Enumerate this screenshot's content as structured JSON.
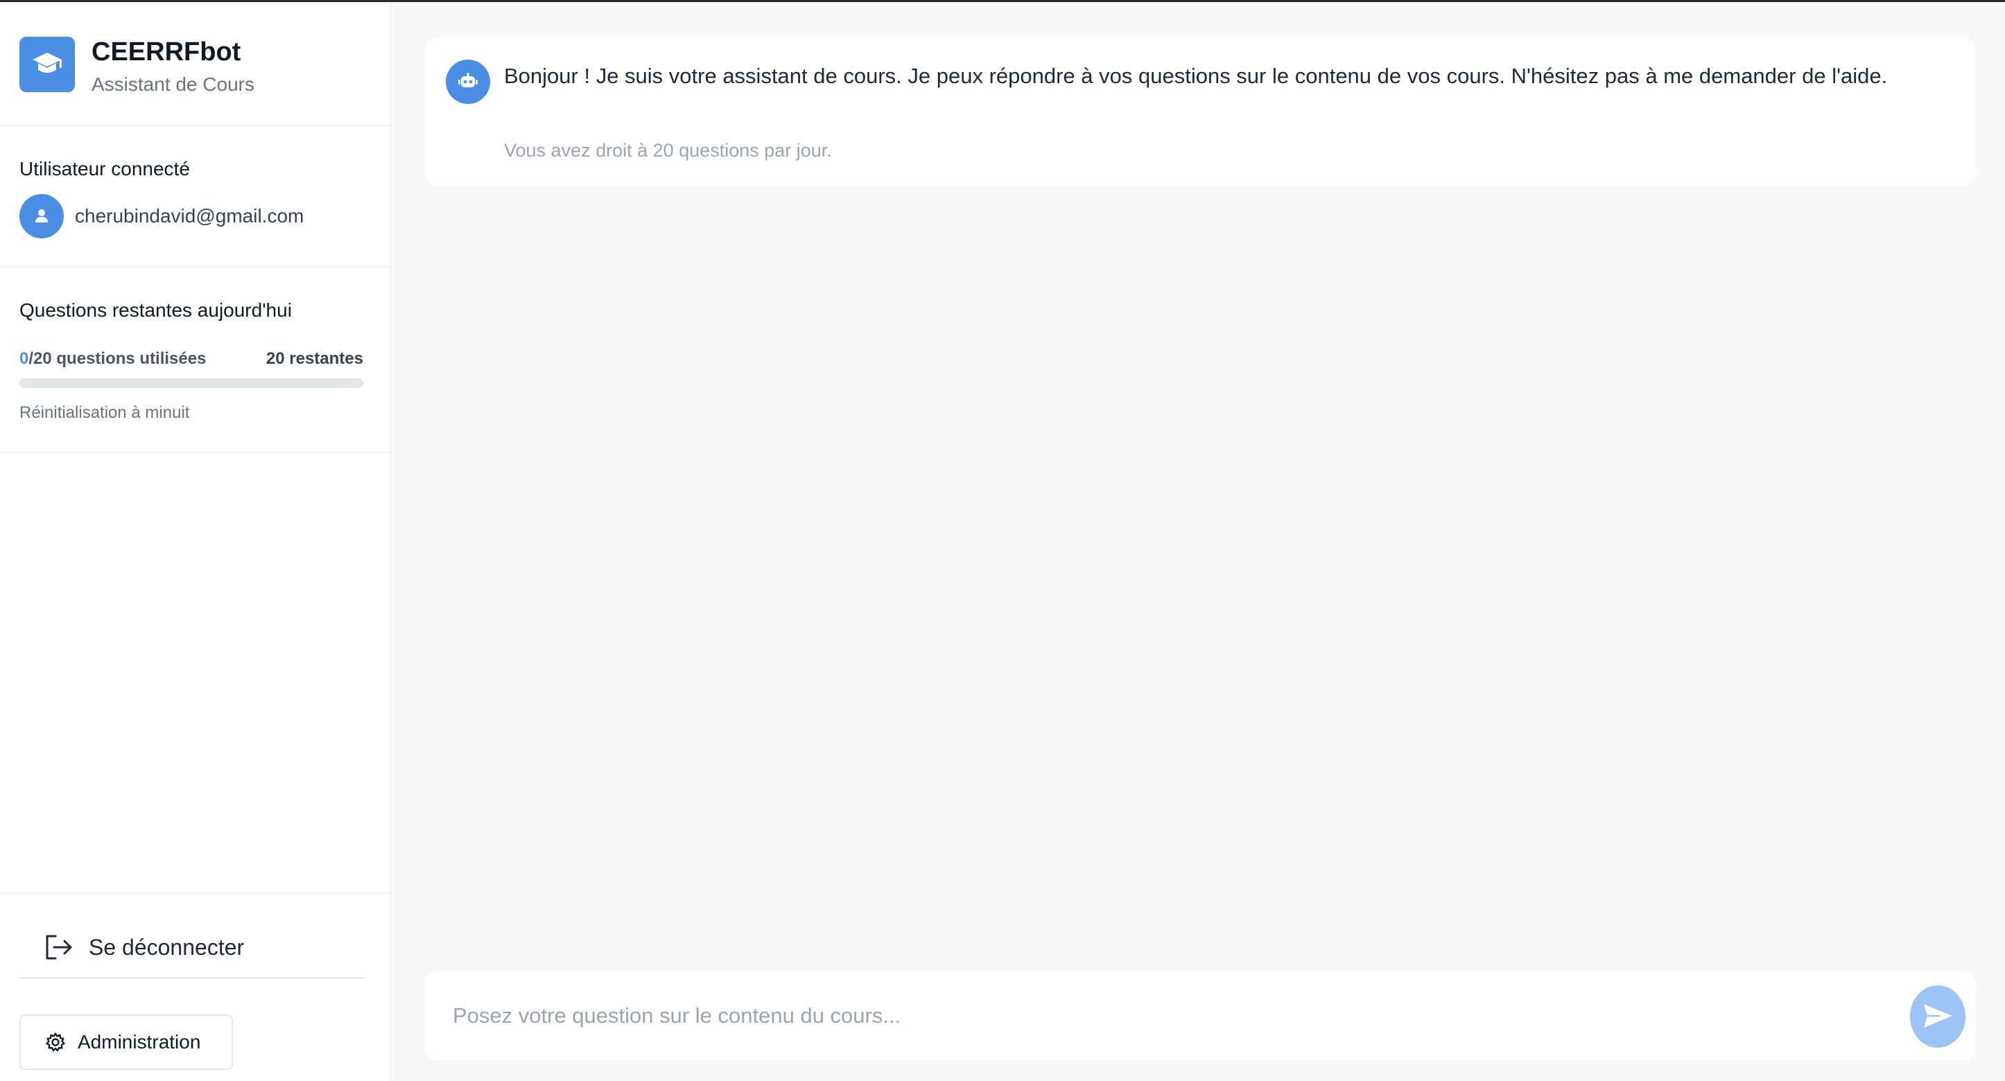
{
  "brand": {
    "title": "CEERRFbot",
    "subtitle": "Assistant de Cours",
    "icon": "graduation-cap-icon"
  },
  "user": {
    "section_title": "Utilisateur connecté",
    "email": "cherubindavid@gmail.com",
    "icon": "user-icon"
  },
  "quota": {
    "section_title": "Questions restantes aujourd'hui",
    "used": "0",
    "used_suffix": "/20 questions utilisées",
    "remaining": "20 restantes",
    "progress_fraction": 0,
    "reset_text": "Réinitialisation à minuit"
  },
  "actions": {
    "logout_label": "Se déconnecter",
    "logout_icon": "logout-icon",
    "admin_label": "Administration",
    "admin_icon": "gear-icon"
  },
  "chat": {
    "bot_icon": "robot-icon",
    "welcome_message": "Bonjour ! Je suis votre assistant de cours. Je peux répondre à vos questions sur le contenu de vos cours. N'hésitez pas à me demander de l'aide.",
    "welcome_note": "Vous avez droit à 20 questions par jour.",
    "input_placeholder": "Posez votre question sur le contenu du cours...",
    "input_value": "",
    "send_icon": "send-icon"
  },
  "colors": {
    "accent": "#4b8ee6",
    "send_disabled": "#9cc3f5",
    "background": "#f9f9fa"
  }
}
